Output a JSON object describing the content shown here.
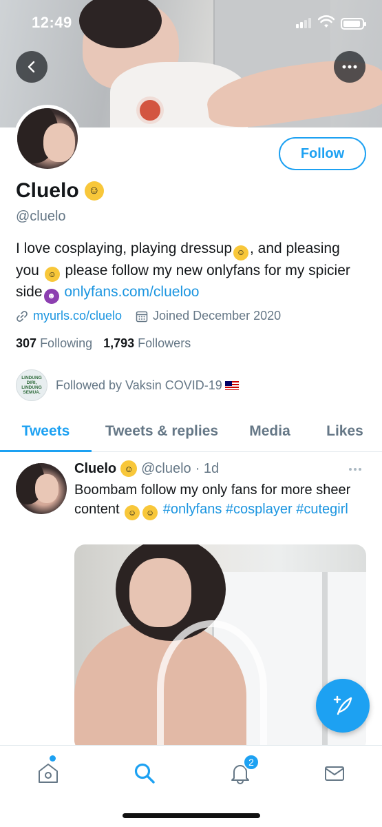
{
  "status_bar": {
    "time": "12:49"
  },
  "profile": {
    "name": "Cluelo",
    "name_emoji": "smiling-face-with-hearts",
    "handle": "@cluelo",
    "follow_label": "Follow",
    "bio": {
      "part1": "I love cosplaying, playing dressup",
      "part2": ", and pleasing you",
      "part3": " please follow my new onlyfans for my spicier side",
      "link": "onlyfans.com/clueloo"
    },
    "website": "myurls.co/cluelo",
    "joined": "Joined December 2020",
    "following_count": "307",
    "following_label": "Following",
    "followers_count": "1,793",
    "followers_label": "Followers",
    "followed_by": "Followed by Vaksin COVID-19",
    "followed_by_avatar_text": "LINDUNG DIRI, LINDUNG SEMUA."
  },
  "tabs": [
    {
      "label": "Tweets",
      "active": true
    },
    {
      "label": "Tweets & replies",
      "active": false
    },
    {
      "label": "Media",
      "active": false
    },
    {
      "label": "Likes",
      "active": false
    }
  ],
  "tweet": {
    "name": "Cluelo",
    "handle": "@cluelo",
    "time": "· 1d",
    "text": "Boombam follow my only fans for more sheer content",
    "hashtags": [
      "#onlyfans",
      "#cosplayer",
      "#cutegirl"
    ]
  },
  "bottom_nav": {
    "notifications_badge": "2"
  },
  "colors": {
    "accent": "#1da1f2",
    "link": "#1b95e0",
    "secondary_text": "#657786"
  }
}
